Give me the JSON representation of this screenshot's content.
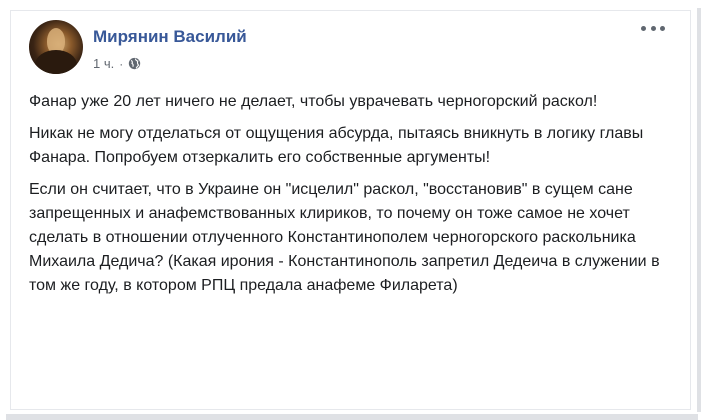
{
  "post": {
    "author": "Мирянин Василий",
    "time": "1 ч.",
    "separator": "·",
    "privacy_icon": "globe-icon",
    "more_icon": "more-options-icon",
    "paragraphs": [
      "Фанар уже 20 лет ничего не делает, чтобы уврачевать черногорский раскол!",
      "Никак не могу отделаться от ощущения абсурда, пытаясь вникнуть в логику главы Фанара. Попробуем отзеркалить его собственные аргументы!",
      "Если он считает, что в Украине он \"исцелил\" раскол, \"восстановив\" в сущем сане запрещенных и анафемствованных клириков, то почему он тоже самое не хочет сделать в отношении отлученного Константинополем черногорского раскольника Михаила Дедича? (Какая ирония - Константинополь запретил Дедеича в служении в том же году, в котором РПЦ предала анафеме Филарета)"
    ]
  },
  "colors": {
    "author": "#385898",
    "text": "#1c1e21",
    "meta": "#616770"
  }
}
